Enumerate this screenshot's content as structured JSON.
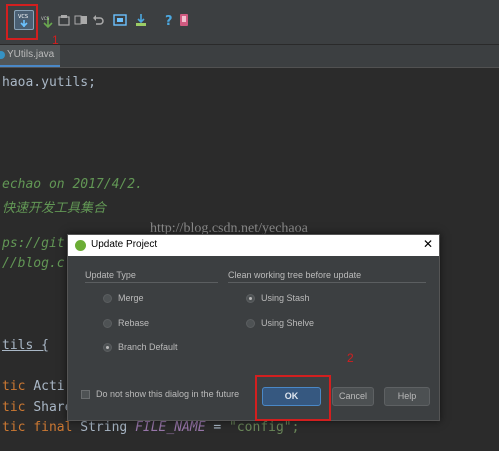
{
  "editor_tab": {
    "filename": "YUtils.java"
  },
  "code": {
    "line_package_tail": "haoa.yutils;",
    "line_author_tail": "echao on 2017/4/2.",
    "line_desc_tail": "快速开发工具集合",
    "line_link1_tail": "ps://git",
    "line_link2_tail": "//blog.c",
    "line_class_tail": "tils {",
    "line_field1_kw": "tic",
    "line_field1_text": "Acti",
    "line_field2_kw": "tic",
    "line_field2_text": "Share",
    "line_field3_kw1": "tic",
    "line_field3_kw2": "final",
    "line_field3_type": "String",
    "line_field3_const": "FILE_NAME",
    "line_field3_eq": "=",
    "line_field3_value": "\"config\";"
  },
  "watermark": "http://blog.csdn.net/yechaoa",
  "annotations": {
    "first": "1",
    "second": "2"
  },
  "dialog": {
    "title": "Update Project",
    "close_glyph": "✕",
    "update_type_label": "Update Type",
    "clean_tree_label": "Clean working tree before update",
    "options_update": [
      {
        "label": "Merge",
        "selected": false
      },
      {
        "label": "Rebase",
        "selected": false
      },
      {
        "label": "Branch Default",
        "selected": true
      }
    ],
    "options_clean": [
      {
        "label": "Using Stash",
        "selected": true
      },
      {
        "label": "Using Shelve",
        "selected": false
      }
    ],
    "checkbox_label": "Do not show this dialog in the future",
    "checkbox_checked": false,
    "ok_label": "OK",
    "cancel_label": "Cancel",
    "help_label": "Help"
  }
}
